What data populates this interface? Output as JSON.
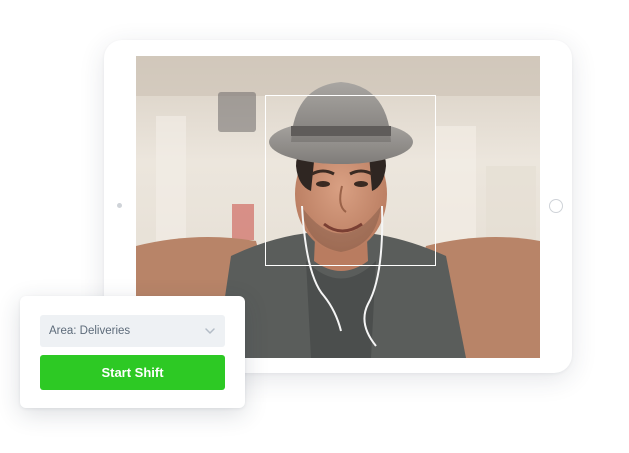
{
  "area_select": {
    "value": "Area: Deliveries",
    "icon": "chevron-down-icon"
  },
  "start_button": {
    "label": "Start Shift",
    "color": "#2dc924"
  },
  "photo": {
    "subject": "selfie-photo",
    "face_detection_box": true
  },
  "colors": {
    "accent": "#2dc924",
    "select_bg": "#eef1f4",
    "select_text": "#5d6b7a"
  }
}
